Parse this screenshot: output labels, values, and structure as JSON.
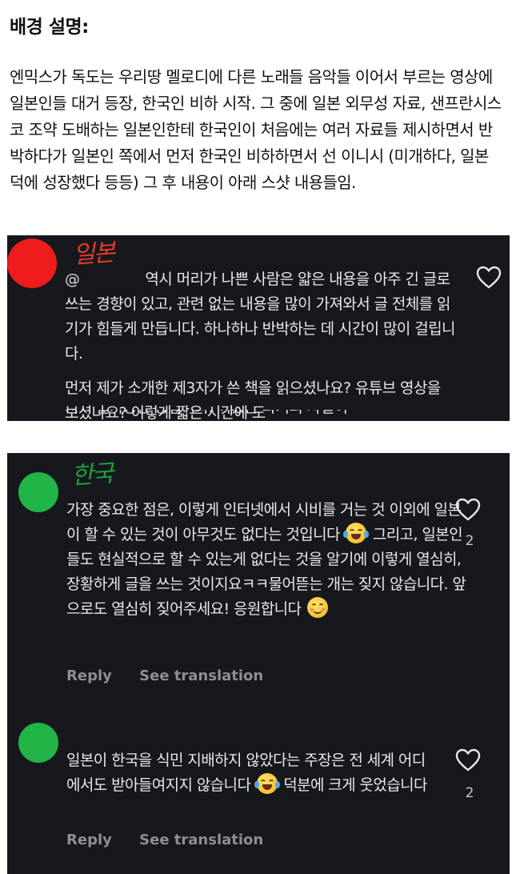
{
  "heading": "배경 설명:",
  "intro": "엔믹스가 독도는 우리땅 멜로디에 다른 노래들 음악들 이어서 부르는 영상에 일본인들 대거 등장, 한국인 비하 시작. 그 중에 일본 외무성 자료, 샌프란시스코 조약 도배하는 일본인한테 한국인이 처음에는 여러 자료들 제시하면서 반박하다가 일본인 쪽에서 먼저 한국인 비하하면서 선 이니시 (미개하다, 일본 덕에 성장했다 등등) 그 후 내용이 아래 스샷 내용들임.",
  "comments": [
    {
      "label": "일본",
      "mention": "@",
      "text1": "역시 머리가 나쁜 사람은 얇은 내용을 아주 긴 글로 쓰는 경향이 있고, 관련 없는 내용을 많이 가져와서 글 전체를 읽기가 힘들게 만듭니다. 하나하나 반박하는 데 시간이 많이 걸립니다.",
      "text2": "먼저 제가 소개한 제3자가 쓴 책을 읽으셨나요? 유튜브 영상을 보셨나요? 이렇게 짧은 시간에 도",
      "cutoff": "저히 불가능한 양입니다. 어쨌든 과거의 사실이"
    },
    {
      "label": "한국",
      "text_a": "가장 중요한 점은, 이렇게 인터넷에서 시비를 거는 것 이외에 일본이 할 수 있는 것이 아무것도 없다는 것입니다",
      "text_b": " 그리고, 일본인들도 현실적으로 할 수 있는게 없다는 것을 알기에 이렇게 열심히, 장황하게 글을 쓰는 것이지요ㅋㅋ물어뜯는 개는 짖지 않습니다. 앞으로도 열심히 짖어주세요! 응원합니다 ",
      "likes": "2",
      "reply": "Reply",
      "translate": "See translation"
    },
    {
      "text_a": "일본이 한국을 식민 지배하지 않았다는 주장은 전 세계 어디에서도 받아들여지지 않습니다",
      "text_b": " 덕분에 크게 웃었습니다",
      "likes": "2",
      "reply": "Reply",
      "translate": "See translation"
    }
  ],
  "icons": {
    "like": "heart-outline-icon",
    "laugh": "tears-of-joy-emoji",
    "smile": "smiling-emoji"
  },
  "colors": {
    "card_bg": "#16181d",
    "red_avatar": "#ee1c1c",
    "green_avatar": "#21b446",
    "action_gray": "#8e8e93"
  }
}
